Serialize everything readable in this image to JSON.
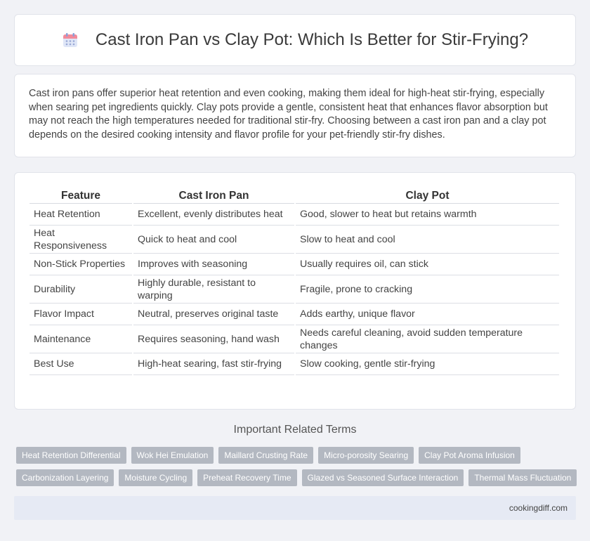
{
  "header": {
    "title": "Cast Iron Pan vs Clay Pot: Which Is Better for Stir-Frying?",
    "icon": "calendar-icon"
  },
  "intro": {
    "text": "Cast iron pans offer superior heat retention and even cooking, making them ideal for high-heat stir-frying, especially when searing pet ingredients quickly. Clay pots provide a gentle, consistent heat that enhances flavor absorption but may not reach the high temperatures needed for traditional stir-fry. Choosing between a cast iron pan and a clay pot depends on the desired cooking intensity and flavor profile for your pet-friendly stir-fry dishes."
  },
  "table": {
    "headers": [
      "Feature",
      "Cast Iron Pan",
      "Clay Pot"
    ],
    "rows": [
      [
        "Heat Retention",
        "Excellent, evenly distributes heat",
        "Good, slower to heat but retains warmth"
      ],
      [
        "Heat Responsiveness",
        "Quick to heat and cool",
        "Slow to heat and cool"
      ],
      [
        "Non-Stick Properties",
        "Improves with seasoning",
        "Usually requires oil, can stick"
      ],
      [
        "Durability",
        "Highly durable, resistant to warping",
        "Fragile, prone to cracking"
      ],
      [
        "Flavor Impact",
        "Neutral, preserves original taste",
        "Adds earthy, unique flavor"
      ],
      [
        "Maintenance",
        "Requires seasoning, hand wash",
        "Needs careful cleaning, avoid sudden temperature changes"
      ],
      [
        "Best Use",
        "High-heat searing, fast stir-frying",
        "Slow cooking, gentle stir-frying"
      ]
    ]
  },
  "related": {
    "title": "Important Related Terms",
    "row1": [
      "Heat Retention Differential",
      "Wok Hei Emulation",
      "Maillard Crusting Rate",
      "Micro-porosity Searing",
      "Clay Pot Aroma Infusion"
    ],
    "row2": [
      "Carbonization Layering",
      "Moisture Cycling",
      "Preheat Recovery Time",
      "Glazed vs Seasoned Surface Interaction",
      "Thermal Mass Fluctuation"
    ]
  },
  "footer": {
    "site": "cookingdiff.com"
  },
  "colors": {
    "background": "#f1f2f6",
    "tag": "#b3b8c1",
    "footer": "#e6eaf4"
  }
}
